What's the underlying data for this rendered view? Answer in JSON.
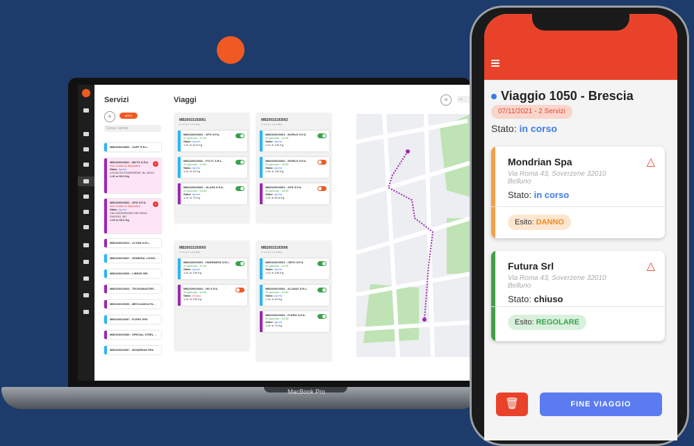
{
  "laptop": {
    "brand_label": "MacBook Pro",
    "app": {
      "servizi": {
        "title": "Servizi",
        "filter_icon": "filter-icon",
        "pill_label": "SERV",
        "search_placeholder": "Cerca i servizi",
        "items": [
          {
            "code": "MB2020029060 - CAFF S.R.L.",
            "color": "#29b6f6"
          },
          {
            "code": "MB2020029301 - MKTG S.P.A.",
            "warn": "Non inviato al dispositivo",
            "state": "Aperto",
            "addr": "LOCALITA SOVERZENE, BL 32010",
            "meta": "1.41 m 62.6 Kg",
            "color": "#9c27b0",
            "badge": "8"
          },
          {
            "code": "MB2020029302 - GPS S.P.A.",
            "warn": "Non inviato al dispositivo",
            "state": "Aperto",
            "addr": "VIA CASSURIANO 246 40041 GAGGIO, BO",
            "meta": "1.41 m 62.6 Kg",
            "color": "#9c27b0",
            "badge": "8"
          },
          {
            "code": "MB2020029310 - CLYNN S.R.L.",
            "color": "#9c27b0"
          },
          {
            "code": "MB2020029307 - GENERAL LOGIS...",
            "color": "#29b6f6"
          },
          {
            "code": "MB2020029305 - LIRESS SRL",
            "color": "#29b6f6"
          },
          {
            "code": "MB2020029303 - TECNOMASTER...",
            "color": "#9c27b0"
          },
          {
            "code": "MB2020029296 - MECCANICA FA...",
            "color": "#9c27b0"
          },
          {
            "code": "MB2020029287 - FLERO SPA",
            "color": "#29b6f6"
          },
          {
            "code": "MB2020029285 - SPECIAL STEEL ...",
            "color": "#9c27b0"
          },
          {
            "code": "MB2020029287 - MONDRIAN SPA",
            "color": "#29b6f6"
          }
        ]
      },
      "viaggi": {
        "title": "Viaggi",
        "search_placeholder": "Ce",
        "trips": [
          {
            "code": "MB20015193001",
            "sub": "P: 21 Kg  V: 1,6 N.Mkg",
            "cards": [
              {
                "title": "MB2020029301 - GPS S.P.A.",
                "date": "20 gennaio - 11:00",
                "state": "Aperto",
                "meta": "1.41 m 62.6 Kg",
                "color": "#29b6f6",
                "toggle": "on"
              },
              {
                "title": "MB2020029302 - FTLTL S.R.L.",
                "date": "20 gennaio - 10:00",
                "state": "Aperto",
                "meta": "1.41 m 40 Kg",
                "color": "#29b6f6",
                "toggle": "on"
              },
              {
                "title": "MB2020029303 - GLASS S.P.A.",
                "date": "20 gennaio - 09:30",
                "state": "Aperto",
                "meta": "1.41 m 70 Kg",
                "color": "#9c27b0",
                "toggle": "on"
              }
            ]
          },
          {
            "code": "MB20015193002",
            "sub": "P: 21 Kg  V: 1,6 N.Mkg",
            "cards": [
              {
                "title": "MB2020029301 - WORLD S.P.A.",
                "date": "20 gennaio - 11:00",
                "state": "Aperto",
                "meta": "1.41 m 100 Kg",
                "color": "#29b6f6",
                "toggle": "on"
              },
              {
                "title": "MB2020029302 - WORLD S.P.A.",
                "date": "20 gennaio - 09:30",
                "state": "Aperto",
                "meta": "1.41 m 100 Kg",
                "color": "#29b6f6",
                "toggle": "off"
              },
              {
                "title": "MB2020029303 - GPS S.P.A.",
                "date": "20 gennaio - 08:30",
                "state": "Aperto",
                "meta": "1.41 m 62.6 Kg",
                "color": "#9c27b0",
                "toggle": "off"
              }
            ]
          },
          {
            "code": "MB20015193005",
            "sub": "P: 21 Kg  V: 1,6 N.Mkg",
            "cards": [
              {
                "title": "MB2020029301 - HARDNESS S.R.L.",
                "date": "20 gennaio - 11:00",
                "state": "Aperto",
                "meta": "1.41 m 100 Kg",
                "color": "#29b6f6",
                "toggle": "on"
              },
              {
                "title": "MB2020029303 - HD S.P.A.",
                "date": "20 gennaio - 10:00",
                "state": "Chiuso",
                "meta": "1.41 m 100 Kg",
                "color": "#9c27b0",
                "toggle": "off"
              }
            ]
          },
          {
            "code": "MB20015193006",
            "sub": "P: 21 Kg  V: 1,6 N.Mkg",
            "cards": [
              {
                "title": "MB2020029301 - CBTO S.P.A.",
                "date": "20 gennaio - 11:00",
                "state": "Aperto",
                "meta": "1.41 m 100 Kg",
                "color": "#29b6f6",
                "toggle": "on"
              },
              {
                "title": "MB2020029302 - ALZANO S.R.L.",
                "date": "20 gennaio - 10:00",
                "state": "Aperto",
                "meta": "1.41 m 40 Kg",
                "color": "#29b6f6",
                "toggle": "on"
              },
              {
                "title": "MB2020029303 - FLERO S.P.A.",
                "date": "20 gennaio - 09:30",
                "state": "Aperto",
                "meta": "1.41 m 70 Kg",
                "color": "#9c27b0",
                "toggle": "on"
              }
            ]
          }
        ]
      }
    }
  },
  "phone": {
    "menu_icon": "hamburger-icon",
    "trip_title": "Viaggio 1050 - Brescia",
    "date_pill": "07/11/2021 - 2 Servizi",
    "status_label": "Stato:",
    "status_value": "in corso",
    "cards": [
      {
        "name": "Mondrian Spa",
        "addr": "Via Roma 43, Soverzene 32010 Belluno",
        "status_label": "Stato:",
        "status_value": "in corso",
        "esito_label": "Esito:",
        "esito_value": "DANNO",
        "color": "#f4a04a",
        "esito_bg": "#fde6cf",
        "esito_color": "#f08a24",
        "status_color": "#3d7be6",
        "icon": "alert-triangle-icon"
      },
      {
        "name": "Futura Srl",
        "addr": "Via Roma 43, Soverzene 32010 Belluno",
        "status_label": "Stato:",
        "status_value": "chiuso",
        "esito_label": "Esito:",
        "esito_value": "REGOLARE",
        "color": "#43a047",
        "esito_bg": "#d9f1dc",
        "esito_color": "#3aa14e",
        "status_color": "#222",
        "icon": "alert-triangle-icon"
      }
    ],
    "delete_icon": "trash-icon",
    "end_button": "FINE VIAGGIO"
  },
  "colors": {
    "accent": "#e8432a",
    "primary_blue": "#5b7bf0",
    "background": "#1d3b6b"
  }
}
